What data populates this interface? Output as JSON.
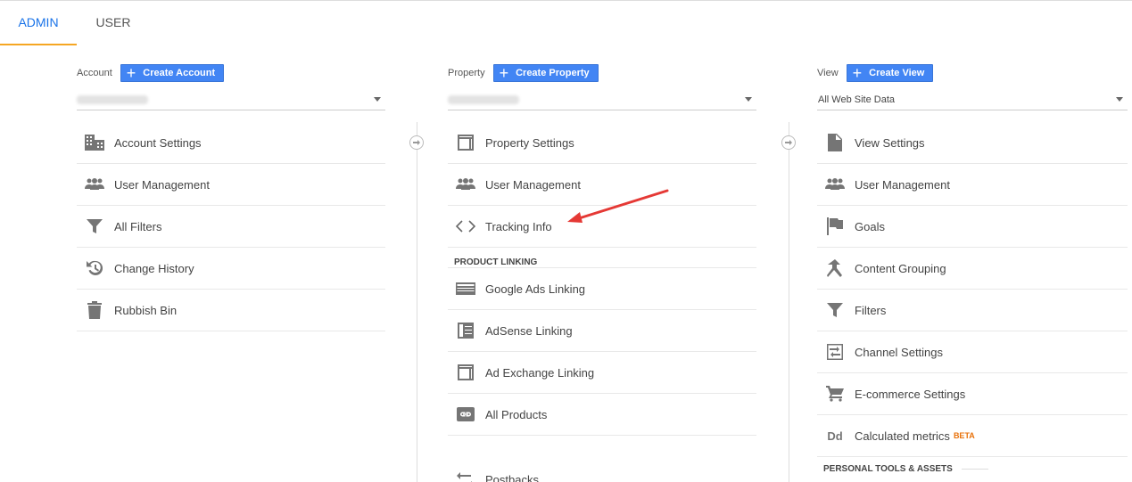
{
  "tabs": {
    "admin": "ADMIN",
    "user": "USER"
  },
  "account": {
    "label": "Account",
    "create_button": "Create Account",
    "items": [
      {
        "label": "Account Settings",
        "icon": "building-icon"
      },
      {
        "label": "User Management",
        "icon": "people-icon"
      },
      {
        "label": "All Filters",
        "icon": "filter-icon"
      },
      {
        "label": "Change History",
        "icon": "history-icon"
      },
      {
        "label": "Rubbish Bin",
        "icon": "trash-icon"
      }
    ]
  },
  "property": {
    "label": "Property",
    "create_button": "Create Property",
    "items": [
      {
        "label": "Property Settings",
        "icon": "layout-icon"
      },
      {
        "label": "User Management",
        "icon": "people-icon"
      },
      {
        "label": "Tracking Info",
        "icon": "code-icon"
      }
    ],
    "section_product_linking": "PRODUCT LINKING",
    "linking_items": [
      {
        "label": "Google Ads Linking",
        "icon": "ads-icon"
      },
      {
        "label": "AdSense Linking",
        "icon": "adsense-icon"
      },
      {
        "label": "Ad Exchange Linking",
        "icon": "layout-icon"
      },
      {
        "label": "All Products",
        "icon": "link-icon"
      },
      {
        "label": "Postbacks",
        "icon": "swap-icon"
      }
    ]
  },
  "view": {
    "label": "View",
    "create_button": "Create View",
    "selected": "All Web Site Data",
    "items": [
      {
        "label": "View Settings",
        "icon": "document-icon"
      },
      {
        "label": "User Management",
        "icon": "people-icon"
      },
      {
        "label": "Goals",
        "icon": "flag-icon"
      },
      {
        "label": "Content Grouping",
        "icon": "grouping-icon"
      },
      {
        "label": "Filters",
        "icon": "filter-icon"
      },
      {
        "label": "Channel Settings",
        "icon": "channel-icon"
      },
      {
        "label": "E-commerce Settings",
        "icon": "cart-icon"
      },
      {
        "label": "Calculated metrics",
        "icon": "dd-icon",
        "badge": "BETA"
      }
    ],
    "section_personal": "PERSONAL TOOLS & ASSETS"
  },
  "annotation": {
    "icon": "red-arrow-icon",
    "color": "#e53935"
  },
  "colors": {
    "accent": "#4285f4",
    "tab_active": "#1a73e8",
    "tab_underline": "#f5a623"
  }
}
